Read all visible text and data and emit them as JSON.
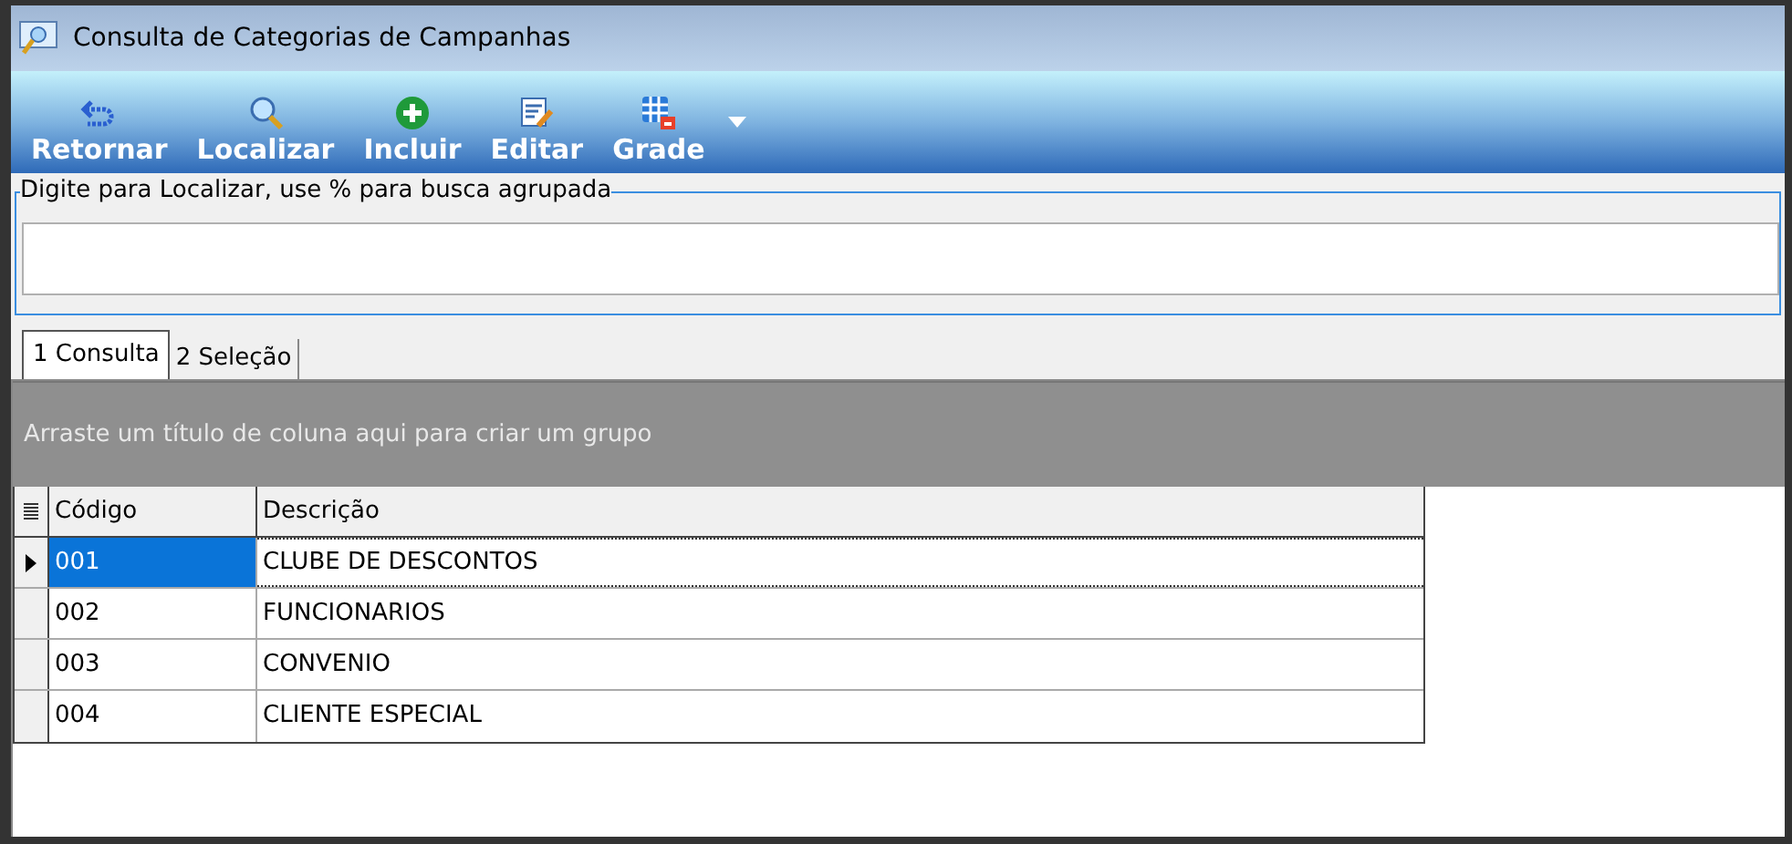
{
  "window": {
    "title": "Consulta de Categorias de Campanhas"
  },
  "toolbar": [
    {
      "kind": "return",
      "label": "Retornar"
    },
    {
      "kind": "search",
      "label": "Localizar"
    },
    {
      "kind": "add",
      "label": "Incluir"
    },
    {
      "kind": "edit",
      "label": "Editar"
    },
    {
      "kind": "grid",
      "label": "Grade"
    }
  ],
  "search": {
    "label": "Digite para Localizar, use % para busca agrupada"
  },
  "tabs": [
    {
      "label": "1 Consulta",
      "selected": true
    },
    {
      "label": "2 Seleção",
      "selected": false
    }
  ],
  "group_panel": {
    "hint": "Arraste um título de coluna aqui para criar um grupo"
  },
  "table": {
    "columns": [
      "Código",
      "Descrição"
    ],
    "rows": [
      {
        "cells": [
          "001",
          "CLUBE DE DESCONTOS"
        ],
        "selected": true
      },
      {
        "cells": [
          "002",
          "FUNCIONARIOS"
        ],
        "selected": false
      },
      {
        "cells": [
          "003",
          "CONVENIO"
        ],
        "selected": false
      },
      {
        "cells": [
          "004",
          "CLIENTE ESPECIAL"
        ],
        "selected": false
      }
    ]
  }
}
